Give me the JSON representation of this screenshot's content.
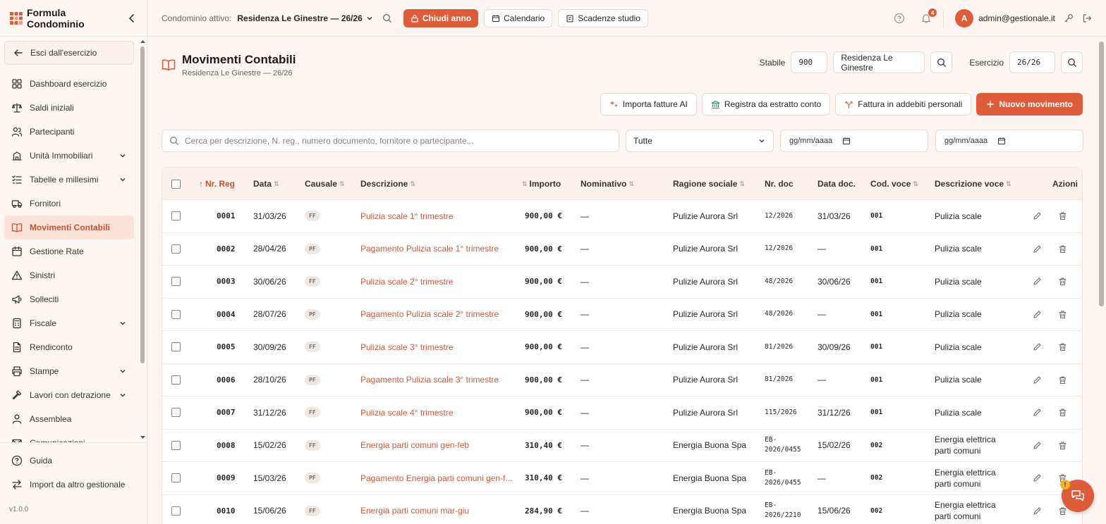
{
  "app": {
    "brand": "Formula Condominio",
    "version": "v1.0.0",
    "accent_color": "#dd5d3b"
  },
  "topbar": {
    "cond_label": "Condominio attivo:",
    "cond_value": "Residenza Le Ginestre — 26/26",
    "close_year": "Chiudi anno",
    "calendar": "Calendario",
    "deadlines": "Scadenze studio",
    "notifications_count": "4",
    "avatar_letter": "A",
    "user_email": "admin@gestionale.it"
  },
  "sidebar": {
    "exit_label": "Esci dall'esercizio",
    "items": [
      {
        "label": "Dashboard esercizio",
        "icon": "dashboard-icon"
      },
      {
        "label": "Saldi iniziali",
        "icon": "scale-icon"
      },
      {
        "label": "Partecipanti",
        "icon": "users-icon"
      },
      {
        "label": "Unità Immobiliari",
        "icon": "building-icon",
        "expandable": true
      },
      {
        "label": "Tabelle e millesimi",
        "icon": "list-check-icon",
        "expandable": true
      },
      {
        "label": "Fornitori",
        "icon": "truck-icon"
      },
      {
        "label": "Movimenti Contabili",
        "icon": "book-icon",
        "active": true
      },
      {
        "label": "Gestione Rate",
        "icon": "calendar-icon"
      },
      {
        "label": "Sinistri",
        "icon": "warning-icon"
      },
      {
        "label": "Solleciti",
        "icon": "megaphone-icon"
      },
      {
        "label": "Fiscale",
        "icon": "calculator-icon",
        "expandable": true
      },
      {
        "label": "Rendiconto",
        "icon": "document-icon"
      },
      {
        "label": "Stampe",
        "icon": "printer-icon",
        "expandable": true
      },
      {
        "label": "Lavori con detrazione",
        "icon": "hammer-icon",
        "expandable": true
      },
      {
        "label": "Assemblea",
        "icon": "people-icon"
      },
      {
        "label": "Comunicazioni",
        "icon": "mail-icon"
      }
    ],
    "footer": [
      {
        "label": "Guida",
        "icon": "help-icon"
      },
      {
        "label": "Import da altro gestionale",
        "icon": "import-icon"
      }
    ]
  },
  "page": {
    "title": "Movimenti Contabili",
    "subtitle": "Residenza Le Ginestre — 26/26",
    "stabile_label": "Stabile",
    "stabile_code": "900",
    "stabile_name": "Residenza Le Ginestre",
    "esercizio_label": "Esercizio",
    "esercizio_value": "26/26"
  },
  "actions": {
    "import_ai": "Importa fatture AI",
    "bank": "Registra da estratto conto",
    "personal": "Fattura in addebiti personali",
    "new": "Nuovo movimento"
  },
  "filters": {
    "search_placeholder": "Cerca per descrizione, N. reg., numero documento, fornitore o partecipante...",
    "type_value": "Tutte",
    "date_from": "gg/mm/aaaa",
    "date_to": "gg/mm/aaaa"
  },
  "table": {
    "headers": {
      "nr_reg": "Nr. Reg",
      "data": "Data",
      "causale": "Causale",
      "descrizione": "Descrizione",
      "importo": "Importo",
      "nominativo": "Nominativo",
      "ragione": "Ragione sociale",
      "nr_doc": "Nr. doc",
      "data_doc": "Data doc.",
      "cod_voce": "Cod. voce",
      "desc_voce": "Descrizione voce",
      "azioni": "Azioni"
    },
    "rows": [
      {
        "nr": "0001",
        "data": "31/03/26",
        "causale": "FF",
        "desc": "Pulizia scale 1° trimestre",
        "importo": "900,00 €",
        "nominativo": "—",
        "ragione": "Pulizie Aurora Srl",
        "doc1": "12/2026",
        "doc2": "",
        "data_doc": "31/03/26",
        "cod": "001",
        "voce1": "Pulizia scale",
        "voce2": ""
      },
      {
        "nr": "0002",
        "data": "28/04/26",
        "causale": "PF",
        "desc": "Pagamento Pulizia scale 1° trimestre",
        "importo": "900,00 €",
        "nominativo": "—",
        "ragione": "Pulizie Aurora Srl",
        "doc1": "12/2026",
        "doc2": "",
        "data_doc": "—",
        "cod": "001",
        "voce1": "Pulizia scale",
        "voce2": ""
      },
      {
        "nr": "0003",
        "data": "30/06/26",
        "causale": "FF",
        "desc": "Pulizia scale 2° trimestre",
        "importo": "900,00 €",
        "nominativo": "—",
        "ragione": "Pulizie Aurora Srl",
        "doc1": "48/2026",
        "doc2": "",
        "data_doc": "30/06/26",
        "cod": "001",
        "voce1": "Pulizia scale",
        "voce2": ""
      },
      {
        "nr": "0004",
        "data": "28/07/26",
        "causale": "PF",
        "desc": "Pagamento Pulizia scale 2° trimestre",
        "importo": "900,00 €",
        "nominativo": "—",
        "ragione": "Pulizie Aurora Srl",
        "doc1": "48/2026",
        "doc2": "",
        "data_doc": "—",
        "cod": "001",
        "voce1": "Pulizia scale",
        "voce2": ""
      },
      {
        "nr": "0005",
        "data": "30/09/26",
        "causale": "FF",
        "desc": "Pulizia scale 3° trimestre",
        "importo": "900,00 €",
        "nominativo": "—",
        "ragione": "Pulizie Aurora Srl",
        "doc1": "81/2026",
        "doc2": "",
        "data_doc": "30/09/26",
        "cod": "001",
        "voce1": "Pulizia scale",
        "voce2": ""
      },
      {
        "nr": "0006",
        "data": "28/10/26",
        "causale": "PF",
        "desc": "Pagamento Pulizia scale 3° trimestre",
        "importo": "900,00 €",
        "nominativo": "—",
        "ragione": "Pulizie Aurora Srl",
        "doc1": "81/2026",
        "doc2": "",
        "data_doc": "—",
        "cod": "001",
        "voce1": "Pulizia scale",
        "voce2": ""
      },
      {
        "nr": "0007",
        "data": "31/12/26",
        "causale": "FF",
        "desc": "Pulizia scale 4° trimestre",
        "importo": "900,00 €",
        "nominativo": "—",
        "ragione": "Pulizie Aurora Srl",
        "doc1": "115/2026",
        "doc2": "",
        "data_doc": "31/12/26",
        "cod": "001",
        "voce1": "Pulizia scale",
        "voce2": ""
      },
      {
        "nr": "0008",
        "data": "15/02/26",
        "causale": "FF",
        "desc": "Energia parti comuni gen-feb",
        "importo": "310,40 €",
        "nominativo": "—",
        "ragione": "Energia Buona Spa",
        "doc1": "EB-",
        "doc2": "2026/0455",
        "data_doc": "15/02/26",
        "cod": "002",
        "voce1": "Energia elettrica",
        "voce2": "parti comuni"
      },
      {
        "nr": "0009",
        "data": "15/03/26",
        "causale": "PF",
        "desc": "Pagamento Energia parti comuni gen-f...",
        "importo": "310,40 €",
        "nominativo": "—",
        "ragione": "Energia Buona Spa",
        "doc1": "EB-",
        "doc2": "2026/0455",
        "data_doc": "—",
        "cod": "002",
        "voce1": "Energia elettrica",
        "voce2": "parti comuni"
      },
      {
        "nr": "0010",
        "data": "15/06/26",
        "causale": "FF",
        "desc": "Energia parti comuni mar-giu",
        "importo": "284,90 €",
        "nominativo": "—",
        "ragione": "Energia Buona Spa",
        "doc1": "EB-",
        "doc2": "2026/2210",
        "data_doc": "15/06/26",
        "cod": "002",
        "voce1": "Energia elettrica",
        "voce2": "parti comuni"
      }
    ]
  }
}
